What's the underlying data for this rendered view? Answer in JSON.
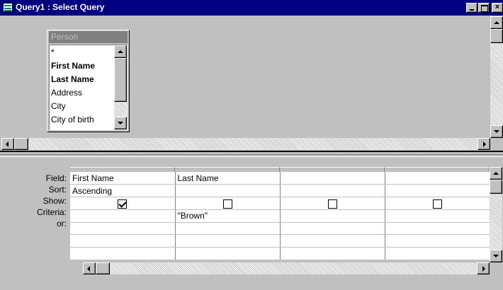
{
  "window": {
    "title": "Query1 : Select Query",
    "icon": "query-icon",
    "controls": [
      "minimize",
      "maximize",
      "close"
    ],
    "close_glyph": "×"
  },
  "table": {
    "name": "Person",
    "fields": [
      "*",
      "First Name",
      "Last Name",
      "Address",
      "City",
      "City of birth"
    ],
    "bold_fields": [
      "First Name",
      "Last Name"
    ]
  },
  "grid": {
    "row_labels": [
      "Field:",
      "Sort:",
      "Show:",
      "Criteria:",
      "or:"
    ],
    "columns": [
      {
        "field": "First Name",
        "sort": "Ascending",
        "show": true,
        "criteria": "",
        "or": ""
      },
      {
        "field": "Last Name",
        "sort": "",
        "show": false,
        "criteria": "\"Brown\"",
        "or": ""
      },
      {
        "field": "",
        "sort": "",
        "show": false,
        "criteria": "",
        "or": ""
      },
      {
        "field": "",
        "sort": "",
        "show": false,
        "criteria": "",
        "or": ""
      }
    ]
  }
}
